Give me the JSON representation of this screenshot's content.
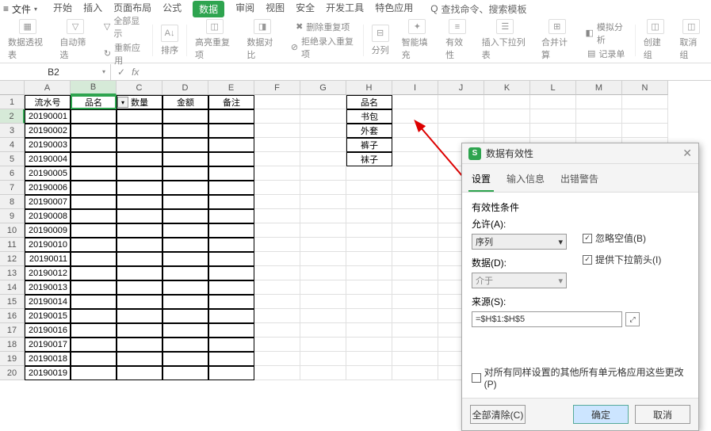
{
  "menubar": {
    "file": "文件",
    "tabs": [
      "开始",
      "插入",
      "页面布局",
      "公式",
      "数据",
      "审阅",
      "视图",
      "安全",
      "开发工具",
      "特色应用"
    ],
    "active_index": 4,
    "search_hint": "查找命令、搜索模板"
  },
  "toolbar": {
    "items": [
      {
        "label": "数据透视表"
      },
      {
        "label": "自动筛选"
      },
      {
        "label_top": "全部显示",
        "label_bot": "重新应用"
      },
      {
        "label": "排序"
      },
      {
        "label": "高亮重复项"
      },
      {
        "label": "数据对比"
      },
      {
        "label_top": "删除重复项",
        "label_bot": "拒绝录入重复项"
      },
      {
        "label": "分列"
      },
      {
        "label": "智能填充"
      },
      {
        "label": "有效性"
      },
      {
        "label": "插入下拉列表"
      },
      {
        "label": "合并计算"
      },
      {
        "label_top": "模拟分析",
        "label_bot": "记录单"
      },
      {
        "label": "创建组"
      },
      {
        "label": "取消组"
      }
    ]
  },
  "formula_bar": {
    "name_box": "B2",
    "fx": "fx"
  },
  "columns": [
    "A",
    "B",
    "C",
    "D",
    "E",
    "F",
    "G",
    "H",
    "I",
    "J",
    "K",
    "L",
    "M",
    "N"
  ],
  "selected_col": 1,
  "selected_row": 1,
  "headers_row1": {
    "A": "流水号",
    "B": "品名",
    "C": "数量",
    "D": "金额",
    "E": "备注",
    "H": "品名"
  },
  "h_col": {
    "2": "书包",
    "3": "外套",
    "4": "裤子",
    "5": "袜子"
  },
  "serials": [
    "20190001",
    "20190002",
    "20190003",
    "20190004",
    "20190005",
    "20190006",
    "20190007",
    "20190008",
    "20190009",
    "20190010",
    "20190011",
    "20190012",
    "20190013",
    "20190014",
    "20190015",
    "20190016",
    "20190017",
    "20190018",
    "20190019"
  ],
  "dialog": {
    "title": "数据有效性",
    "tabs": [
      "设置",
      "输入信息",
      "出错警告"
    ],
    "active_tab": 0,
    "cond_label": "有效性条件",
    "allow_label": "允许(A):",
    "allow_value": "序列",
    "data_label": "数据(D):",
    "data_value": "介于",
    "source_label": "来源(S):",
    "source_value": "=$H$1:$H$5",
    "ignore_blank": "忽略空值(B)",
    "dropdown_arrow": "提供下拉箭头(I)",
    "apply_all": "对所有同样设置的其他所有单元格应用这些更改(P)",
    "clear": "全部清除(C)",
    "ok": "确定",
    "cancel": "取消"
  }
}
